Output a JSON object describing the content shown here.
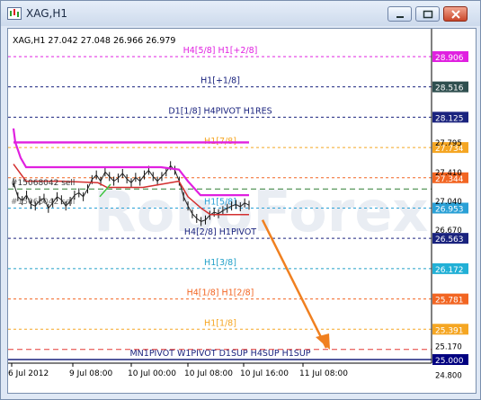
{
  "window": {
    "title": "XAG,H1"
  },
  "chart_header": {
    "text": "XAG,H1  27.042 27.048 26.966 26.979"
  },
  "watermark": "RoboForex",
  "chart_data": {
    "type": "line",
    "symbol": "XAG",
    "timeframe": "H1",
    "ohlc": {
      "open": 27.042,
      "high": 27.048,
      "low": 26.966,
      "close": 26.979
    },
    "x_ticks": [
      "6 Jul 2012",
      "9 Jul 08:00",
      "10 Jul 00:00",
      "10 Jul 08:00",
      "10 Jul 16:00",
      "11 Jul 08:00"
    ],
    "y_ticks": [
      28.906,
      28.516,
      28.125,
      27.734,
      27.344,
      26.953,
      26.563,
      26.172,
      25.781,
      25.391,
      25.0,
      24.8
    ],
    "extra_y_ticks": [
      27.795,
      27.41,
      27.04,
      26.67,
      25.17
    ],
    "ylim": [
      24.75,
      29.25
    ],
    "levels": [
      {
        "label": "H4[5/8] H1[+2/8]",
        "value": 28.906,
        "color": "#e020e0",
        "box": "#e020e0"
      },
      {
        "label": "H1[+1/8]",
        "value": 28.516,
        "color": "#1a237e",
        "box": "#2f4f4f"
      },
      {
        "label": "D1[1/8] H4PIVOT H1RES",
        "value": 28.125,
        "color": "#1a237e",
        "box": "#1a237e"
      },
      {
        "label": "H1[7/8]",
        "value": 27.734,
        "color": "#f5a623",
        "box": "#f5a623"
      },
      {
        "label": "",
        "value": 27.344,
        "color": "#f26522",
        "box": "#f26522"
      },
      {
        "label": "H1[5/8]",
        "value": 26.953,
        "color": "#2aa0d6",
        "box": "#2aa0d6"
      },
      {
        "label": "H4[2/8] H1PIVOT",
        "value": 26.563,
        "color": "#1a237e",
        "box": "#1a237e"
      },
      {
        "label": "H1[3/8]",
        "value": 26.172,
        "color": "#22a0c8",
        "box": "#22b0d6"
      },
      {
        "label": "H4[1/8] H1[2/8]",
        "value": 25.781,
        "color": "#f26522",
        "box": "#f26522"
      },
      {
        "label": "H1[1/8]",
        "value": 25.391,
        "color": "#f5a623",
        "box": "#f5a623"
      },
      {
        "label": "MN1PIVOT W1PIVOT D1SUP H4SUP H1SUP",
        "value": 25.0,
        "color": "#1a237e",
        "box": "#000080"
      }
    ],
    "order_label": "#15068042 sell",
    "order_label_2": "#15068042 sell",
    "forecast_arrow": {
      "from": [
        26.85,
        "10 Jul 16:00"
      ],
      "to": [
        25.1,
        "11 Jul 08:00"
      ],
      "color": "#f08020"
    }
  }
}
